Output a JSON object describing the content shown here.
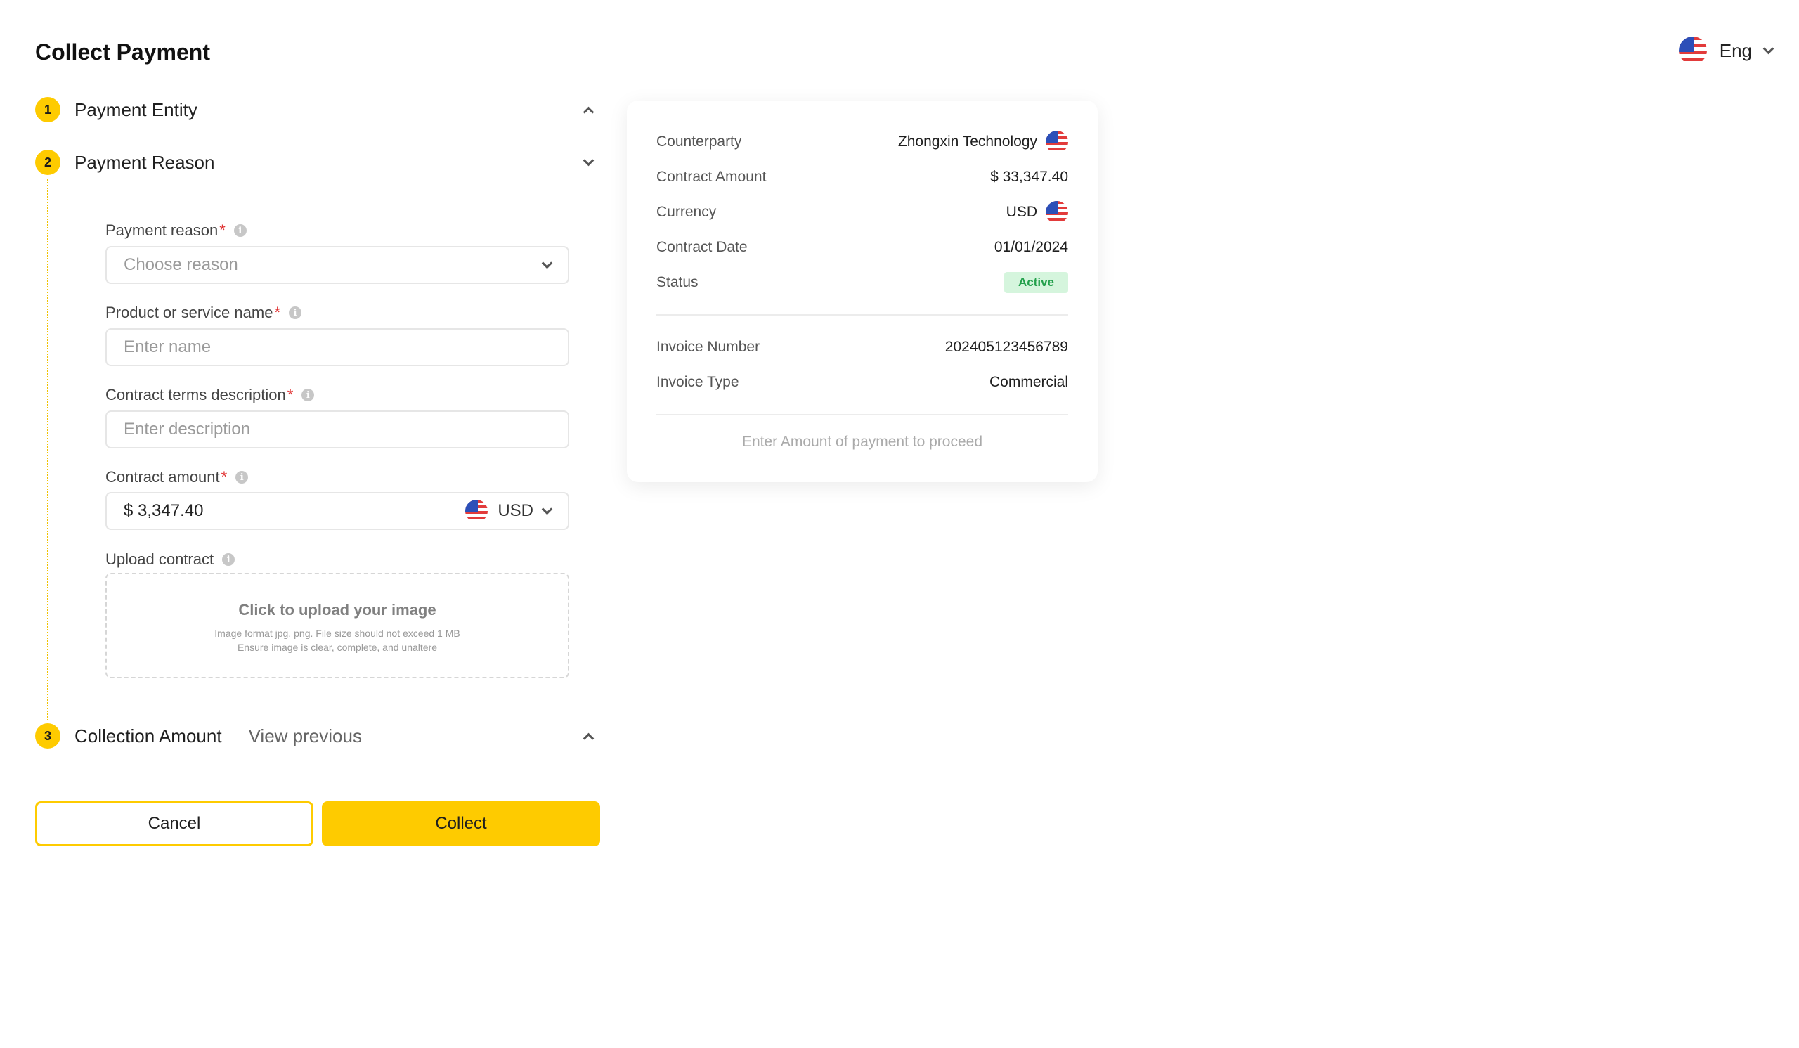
{
  "page": {
    "title": "Collect Payment"
  },
  "language": {
    "label": "Eng",
    "flag": "us-flag-icon"
  },
  "steps": [
    {
      "number": "1",
      "title": "Payment Entity"
    },
    {
      "number": "2",
      "title": "Payment Reason"
    },
    {
      "number": "3",
      "title": "Collection Amount",
      "link": "View previous"
    }
  ],
  "form": {
    "payment_reason": {
      "label": "Payment reason",
      "required": "*",
      "placeholder": "Choose reason"
    },
    "product_name": {
      "label": "Product or service name",
      "required": "*",
      "placeholder": "Enter name"
    },
    "contract_terms": {
      "label": "Contract terms description",
      "required": "*",
      "placeholder": "Enter description"
    },
    "contract_amount": {
      "label": "Contract amount",
      "required": "*",
      "value": "$ 3,347.40",
      "currency": "USD"
    },
    "upload": {
      "label": "Upload contract",
      "title": "Click to upload your image",
      "hint1": "Image format jpg, png. File size should not exceed 1 MB",
      "hint2": "Ensure image is clear, complete, and unaltere"
    }
  },
  "actions": {
    "cancel": "Cancel",
    "collect": "Collect"
  },
  "summary": {
    "counterparty": {
      "label": "Counterparty",
      "value": "Zhongxin Technology"
    },
    "contract_amount": {
      "label": "Contract Amount",
      "value": "$ 33,347.40"
    },
    "currency": {
      "label": "Currency",
      "value": "USD"
    },
    "contract_date": {
      "label": "Contract Date",
      "value": "01/01/2024"
    },
    "status": {
      "label": "Status",
      "value": "Active"
    },
    "invoice_number": {
      "label": "Invoice Number",
      "value": "202405123456789"
    },
    "invoice_type": {
      "label": "Invoice Type",
      "value": "Commercial"
    },
    "proceed_hint": "Enter Amount of payment to proceed"
  },
  "colors": {
    "accent": "#fecb00",
    "status_bg": "#d5f5dd",
    "status_text": "#22a04b",
    "required": "#e03131"
  }
}
